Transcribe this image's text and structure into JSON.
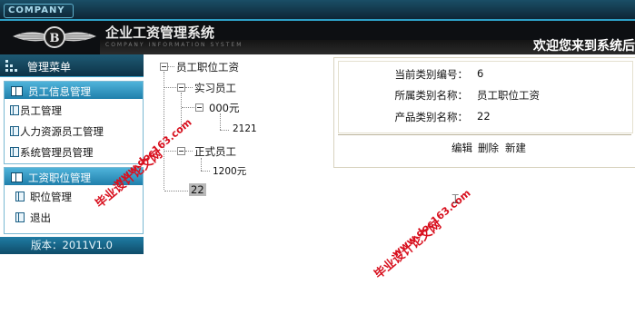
{
  "header": {
    "company": "COMPANY",
    "title": "企业工资管理系统",
    "subtitle": "COMPANY INFORMATION SYSTEM",
    "welcome": "欢迎您来到系统后"
  },
  "sidebar": {
    "menu_title": "管理菜单",
    "sections": [
      {
        "title": "员工信息管理",
        "items": [
          "员工管理",
          "人力资源员工管理",
          "系统管理员管理"
        ]
      },
      {
        "title": "工资职位管理",
        "items": [
          "职位管理",
          "退出"
        ]
      }
    ],
    "version": "版本：2011V1.0"
  },
  "tree": {
    "root": "员工职位工资",
    "child1": "实习员工",
    "child1_sub": "000元",
    "child1_leaf": "2121",
    "child2": "正式员工",
    "child2_leaf": "1200元",
    "selected": "22"
  },
  "detail": {
    "rows": [
      {
        "label": "当前类别编号：",
        "value": "6"
      },
      {
        "label": "所属类别名称：",
        "value": "员工职位工资"
      },
      {
        "label": "产品类别名称：",
        "value": "22"
      }
    ],
    "actions": [
      "编辑",
      "删除",
      "新建"
    ]
  },
  "watermarks": [
    {
      "title": "毕业设计论文网",
      "url": "www.doc163.com"
    },
    {
      "title": "毕业设计论文网",
      "url": "www.doc163.com"
    }
  ]
}
